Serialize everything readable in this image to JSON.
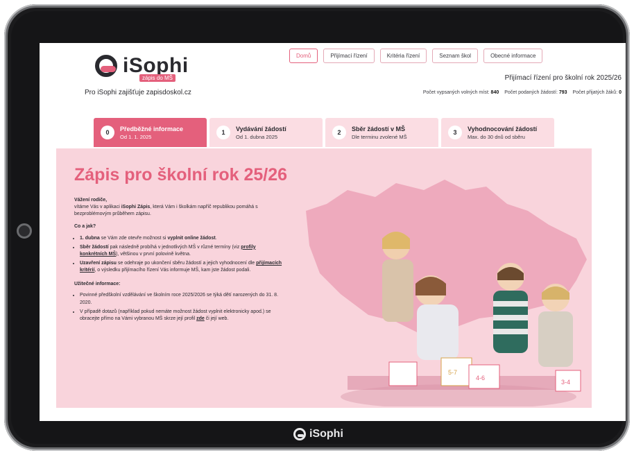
{
  "branding": {
    "logo_text": "iSophi",
    "logo_sub": "zápis do MŠ",
    "tagline": "Pro iSophi zajišťuje zapisdoskol.cz",
    "device_logo": "iSophi"
  },
  "nav": {
    "items": [
      {
        "label": "Domů",
        "active": true
      },
      {
        "label": "Přijímací řízení"
      },
      {
        "label": "Kritéria řízení"
      },
      {
        "label": "Seznam škol"
      },
      {
        "label": "Obecné informace"
      }
    ]
  },
  "header": {
    "period": "Přijímací řízení pro školní rok 2025/26",
    "stats": {
      "free_label": "Počet vypsaných volných míst:",
      "free_value": "840",
      "submitted_label": "Počet podaných žádostí:",
      "submitted_value": "793",
      "accepted_label": "Počet přijatých žáků:",
      "accepted_value": "0"
    }
  },
  "steps": [
    {
      "num": "0",
      "title": "Předběžné informace",
      "sub": "Od 1. 1. 2025",
      "active": true
    },
    {
      "num": "1",
      "title": "Vydávání žádostí",
      "sub": "Od 1. dubna 2025"
    },
    {
      "num": "2",
      "title": "Sběr žádostí v MŠ",
      "sub": "Dle terminu zvolené MŠ"
    },
    {
      "num": "3",
      "title": "Vyhodnocování žádostí",
      "sub": "Max. do 30 dnů od sběru"
    }
  ],
  "hero": {
    "title": "Zápis pro školní rok 25/26",
    "greeting": "Vážení rodiče,",
    "intro_1": "vítáme Vás v aplikaci ",
    "intro_bold": "iSophi Zápis",
    "intro_2": ", která Vám i školkám napříč republikou pomáhá s bezproblémovým průběhem zápisu.",
    "how_head": "Co a jak?",
    "b1_bold": "1. dubna",
    "b1_text": " se Vám zde otevře možnost si ",
    "b1_bold2": "vyplnit online žádost",
    "b1_end": ".",
    "b2_bold": "Sběr žádostí",
    "b2_text": " pak následně probíhá v jednotlivých MŠ v různé termíny (viz ",
    "b2_link": "profily konkrétních MŠ",
    "b2_end": "), většinou v první polovině května.",
    "b3_bold": "Uzavření zápisu",
    "b3_text": " se odehraje po ukončení sběru žádostí a jejich vyhodnocení dle ",
    "b3_link": "přijímacích kritérií",
    "b3_end": ", o výsledku přijímacího řízení Vás informuje MŠ, kam jste žádost podali.",
    "useful_head": "Užitečné informace:",
    "u1": "Povinné předškolní vzdělávání ve školním roce 2025/2026 se týká dětí narozených do 31. 8. 2020.",
    "u2_text": "V případě dotazů (například pokud nemáte možnost žádost vyplnit elektronicky apod.) se obracejte přímo na Vámi vybranou MŠ skrze její profil ",
    "u2_link": "zde",
    "u2_end": " či její web.",
    "box_labels": [
      "5-7",
      "4-6",
      "3-4"
    ]
  },
  "colors": {
    "accent": "#e4607c",
    "hero_bg": "#f9d4dc",
    "step_bg": "#fbdde3",
    "map": "#eeaabd"
  }
}
